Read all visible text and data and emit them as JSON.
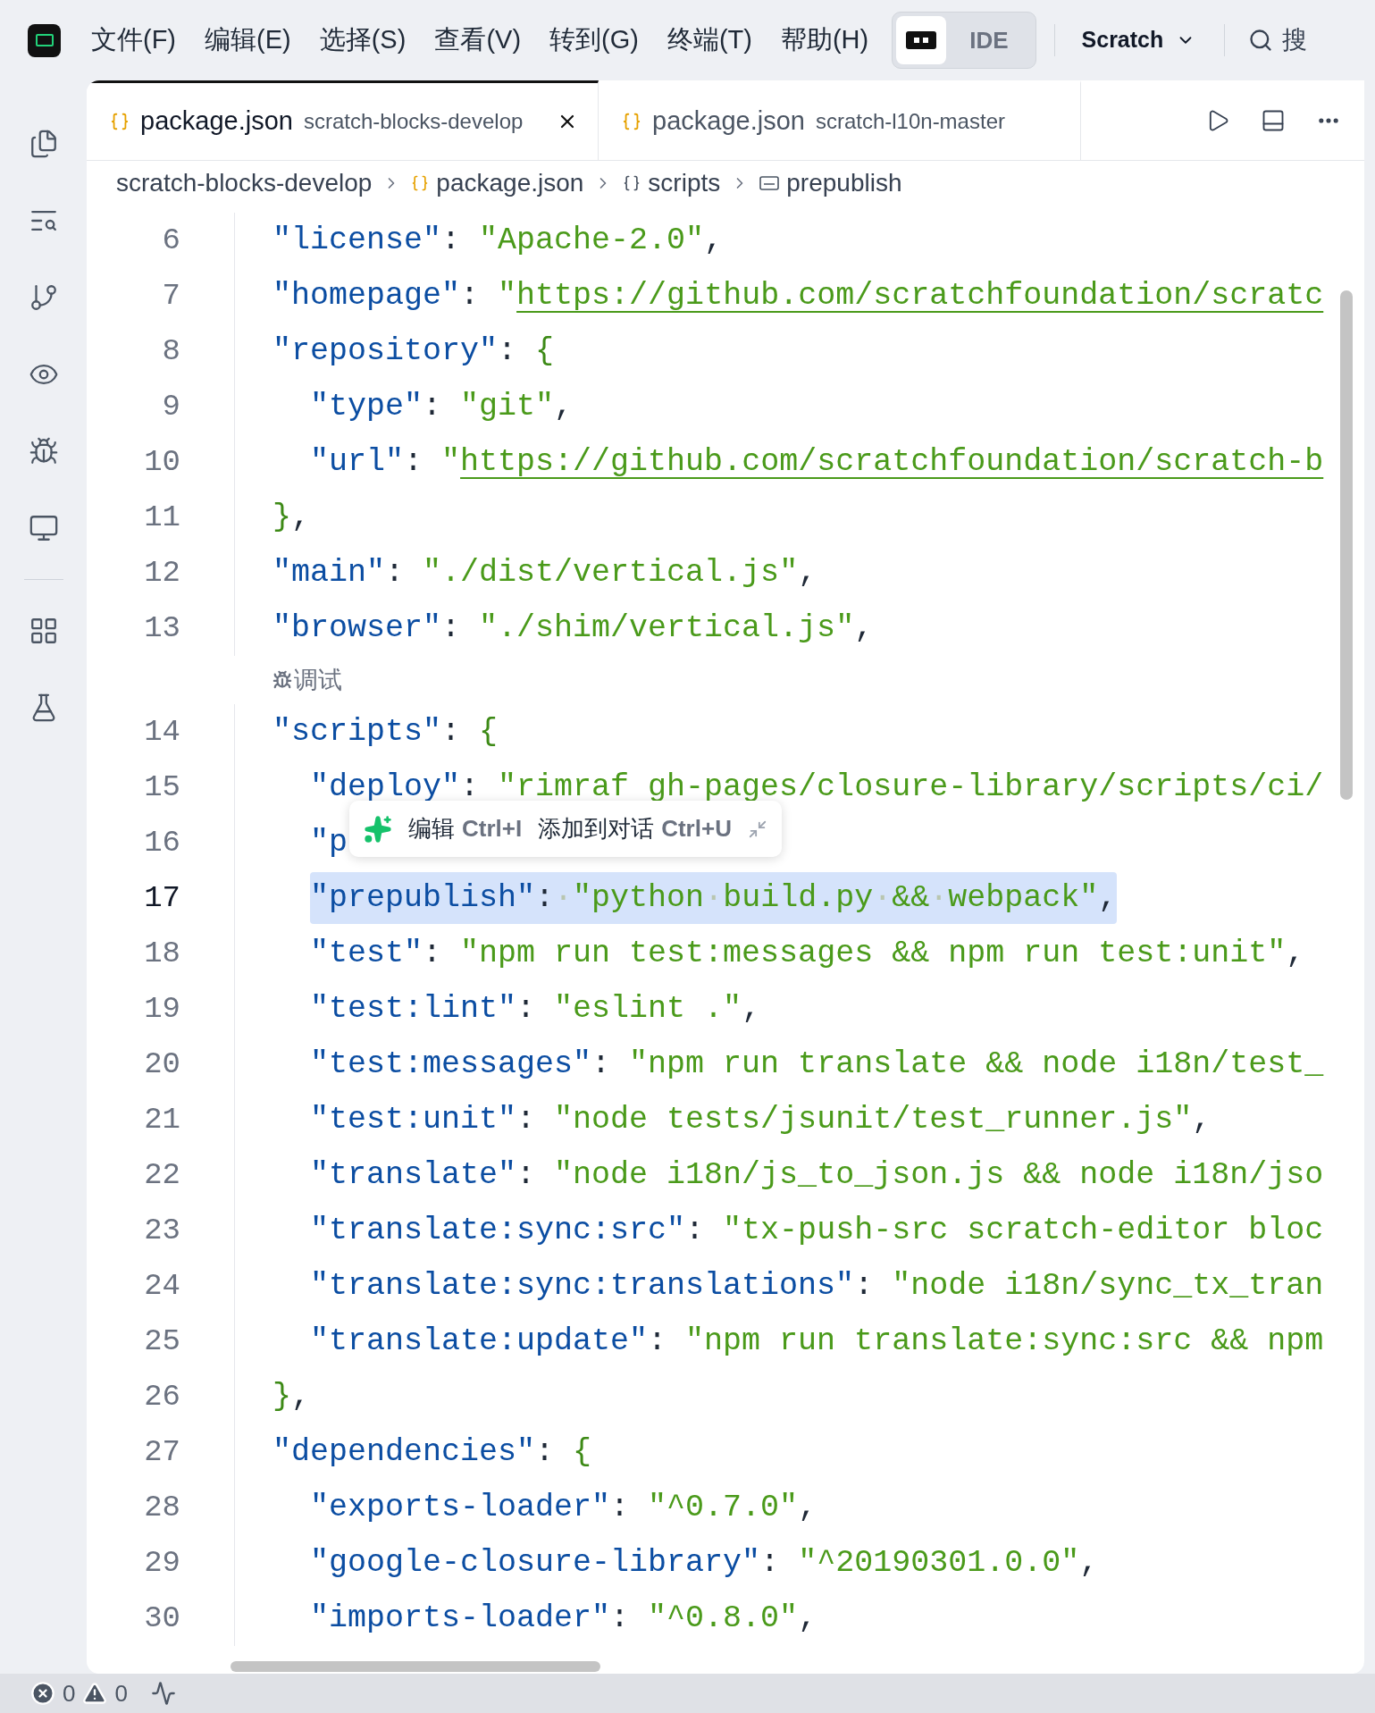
{
  "menu": [
    "文件(F)",
    "编辑(E)",
    "选择(S)",
    "查看(V)",
    "转到(G)",
    "终端(T)",
    "帮助(H)"
  ],
  "mode_switch": [
    {
      "kind": "icon",
      "selected": true
    },
    {
      "kind": "text",
      "label": "IDE",
      "selected": false
    }
  ],
  "project": "Scratch",
  "search": {
    "label": "搜"
  },
  "tabs": [
    {
      "label": "package.json",
      "description": "scratch-blocks-develop",
      "selected": true,
      "closable": true
    },
    {
      "label": "package.json",
      "description": "scratch-l10n-master",
      "selected": false,
      "closable": false
    }
  ],
  "breadcrumb": [
    {
      "kind": "folder",
      "label": "scratch-blocks-develop"
    },
    {
      "kind": "json",
      "label": "package.json"
    },
    {
      "kind": "object",
      "label": "scripts"
    },
    {
      "kind": "string",
      "label": "prepublish"
    }
  ],
  "lines": [
    {
      "number": "6",
      "selected": false,
      "tokens": [
        {
          "kind": "key",
          "text": "  \"license\""
        },
        {
          "kind": "punct",
          "text": ": "
        },
        {
          "kind": "string",
          "text": "\"Apache-2.0\""
        },
        {
          "kind": "punct",
          "text": ","
        }
      ]
    },
    {
      "number": "7",
      "selected": false,
      "tokens": [
        {
          "kind": "key",
          "text": "  \"homepage\""
        },
        {
          "kind": "punct",
          "text": ": "
        },
        {
          "kind": "string",
          "text": "\""
        },
        {
          "kind": "link",
          "text": "https://github.com/scratchfoundation/scratc"
        }
      ]
    },
    {
      "number": "8",
      "selected": false,
      "tokens": [
        {
          "kind": "key",
          "text": "  \"repository\""
        },
        {
          "kind": "punct",
          "text": ": "
        },
        {
          "kind": "brace",
          "text": "{"
        }
      ]
    },
    {
      "number": "9",
      "selected": false,
      "tokens": [
        {
          "kind": "key",
          "text": "    \"type\""
        },
        {
          "kind": "punct",
          "text": ": "
        },
        {
          "kind": "string",
          "text": "\"git\""
        },
        {
          "kind": "punct",
          "text": ","
        }
      ]
    },
    {
      "number": "10",
      "selected": false,
      "tokens": [
        {
          "kind": "key",
          "text": "    \"url\""
        },
        {
          "kind": "punct",
          "text": ": "
        },
        {
          "kind": "string",
          "text": "\""
        },
        {
          "kind": "link",
          "text": "https://github.com/scratchfoundation/scratch-b"
        }
      ]
    },
    {
      "number": "11",
      "selected": false,
      "tokens": [
        {
          "kind": "brace",
          "text": "  }"
        },
        {
          "kind": "punct",
          "text": ","
        }
      ]
    },
    {
      "number": "12",
      "selected": false,
      "tokens": [
        {
          "kind": "key",
          "text": "  \"main\""
        },
        {
          "kind": "punct",
          "text": ": "
        },
        {
          "kind": "string",
          "text": "\"./dist/vertical.js\""
        },
        {
          "kind": "punct",
          "text": ","
        }
      ]
    },
    {
      "number": "13",
      "selected": false,
      "tokens": [
        {
          "kind": "key",
          "text": "  \"browser\""
        },
        {
          "kind": "punct",
          "text": ": "
        },
        {
          "kind": "string",
          "text": "\"./shim/vertical.js\""
        },
        {
          "kind": "punct",
          "text": ","
        }
      ]
    },
    {
      "kind": "codelens",
      "label": "调试"
    },
    {
      "number": "14",
      "selected": false,
      "tokens": [
        {
          "kind": "key",
          "text": "  \"scripts\""
        },
        {
          "kind": "punct",
          "text": ": "
        },
        {
          "kind": "brace",
          "text": "{"
        }
      ]
    },
    {
      "number": "15",
      "selected": false,
      "tokens": [
        {
          "kind": "key",
          "text": "    \"deploy\""
        },
        {
          "kind": "punct",
          "text": ": "
        },
        {
          "kind": "string",
          "text": "\"rimraf gh-pages/closure-library/scripts/ci/"
        }
      ]
    },
    {
      "number": "16",
      "selected": false,
      "tokens": [
        {
          "kind": "key",
          "text": "    \"p"
        }
      ]
    },
    {
      "number": "17",
      "selected": true,
      "tokens": [
        {
          "kind": "key",
          "text": "    \"prepublish\""
        },
        {
          "kind": "punct",
          "text": ":"
        },
        {
          "kind": "space",
          "text": "·"
        },
        {
          "kind": "string",
          "text": "\"python"
        },
        {
          "kind": "space",
          "text": "·"
        },
        {
          "kind": "string",
          "text": "build.py"
        },
        {
          "kind": "space",
          "text": "·"
        },
        {
          "kind": "string",
          "text": "&&"
        },
        {
          "kind": "space",
          "text": "·"
        },
        {
          "kind": "string",
          "text": "webpack\""
        },
        {
          "kind": "punct",
          "text": ","
        }
      ]
    },
    {
      "number": "18",
      "selected": false,
      "tokens": [
        {
          "kind": "key",
          "text": "    \"test\""
        },
        {
          "kind": "punct",
          "text": ": "
        },
        {
          "kind": "string",
          "text": "\"npm run test:messages && npm run test:unit\""
        },
        {
          "kind": "punct",
          "text": ","
        }
      ]
    },
    {
      "number": "19",
      "selected": false,
      "tokens": [
        {
          "kind": "key",
          "text": "    \"test:lint\""
        },
        {
          "kind": "punct",
          "text": ": "
        },
        {
          "kind": "string",
          "text": "\"eslint .\""
        },
        {
          "kind": "punct",
          "text": ","
        }
      ]
    },
    {
      "number": "20",
      "selected": false,
      "tokens": [
        {
          "kind": "key",
          "text": "    \"test:messages\""
        },
        {
          "kind": "punct",
          "text": ": "
        },
        {
          "kind": "string",
          "text": "\"npm run translate && node i18n/test_"
        }
      ]
    },
    {
      "number": "21",
      "selected": false,
      "tokens": [
        {
          "kind": "key",
          "text": "    \"test:unit\""
        },
        {
          "kind": "punct",
          "text": ": "
        },
        {
          "kind": "string",
          "text": "\"node tests/jsunit/test_runner.js\""
        },
        {
          "kind": "punct",
          "text": ","
        }
      ]
    },
    {
      "number": "22",
      "selected": false,
      "tokens": [
        {
          "kind": "key",
          "text": "    \"translate\""
        },
        {
          "kind": "punct",
          "text": ": "
        },
        {
          "kind": "string",
          "text": "\"node i18n/js_to_json.js && node i18n/jso"
        }
      ]
    },
    {
      "number": "23",
      "selected": false,
      "tokens": [
        {
          "kind": "key",
          "text": "    \"translate:sync:src\""
        },
        {
          "kind": "punct",
          "text": ": "
        },
        {
          "kind": "string",
          "text": "\"tx-push-src scratch-editor bloc"
        }
      ]
    },
    {
      "number": "24",
      "selected": false,
      "tokens": [
        {
          "kind": "key",
          "text": "    \"translate:sync:translations\""
        },
        {
          "kind": "punct",
          "text": ": "
        },
        {
          "kind": "string",
          "text": "\"node i18n/sync_tx_tran"
        }
      ]
    },
    {
      "number": "25",
      "selected": false,
      "tokens": [
        {
          "kind": "key",
          "text": "    \"translate:update\""
        },
        {
          "kind": "punct",
          "text": ": "
        },
        {
          "kind": "string",
          "text": "\"npm run translate:sync:src && npm"
        }
      ]
    },
    {
      "number": "26",
      "selected": false,
      "tokens": [
        {
          "kind": "brace",
          "text": "  }"
        },
        {
          "kind": "punct",
          "text": ","
        }
      ]
    },
    {
      "number": "27",
      "selected": false,
      "tokens": [
        {
          "kind": "key",
          "text": "  \"dependencies\""
        },
        {
          "kind": "punct",
          "text": ": "
        },
        {
          "kind": "brace",
          "text": "{"
        }
      ]
    },
    {
      "number": "28",
      "selected": false,
      "tokens": [
        {
          "kind": "key",
          "text": "    \"exports-loader\""
        },
        {
          "kind": "punct",
          "text": ": "
        },
        {
          "kind": "string",
          "text": "\"^0.7.0\""
        },
        {
          "kind": "punct",
          "text": ","
        }
      ]
    },
    {
      "number": "29",
      "selected": false,
      "tokens": [
        {
          "kind": "key",
          "text": "    \"google-closure-library\""
        },
        {
          "kind": "punct",
          "text": ": "
        },
        {
          "kind": "string",
          "text": "\"^20190301.0.0\""
        },
        {
          "kind": "punct",
          "text": ","
        }
      ]
    },
    {
      "number": "30",
      "selected": false,
      "tokens": [
        {
          "kind": "key",
          "text": "    \"imports-loader\""
        },
        {
          "kind": "punct",
          "text": ": "
        },
        {
          "kind": "string",
          "text": "\"^0.8.0\""
        },
        {
          "kind": "punct",
          "text": ","
        }
      ]
    }
  ],
  "inline_popup": {
    "actions": [
      {
        "label": "编辑",
        "shortcut": "Ctrl+I"
      },
      {
        "label": "添加到对话",
        "shortcut": "Ctrl+U"
      }
    ]
  },
  "status_bar": {
    "errors": "0",
    "warnings": "0"
  }
}
